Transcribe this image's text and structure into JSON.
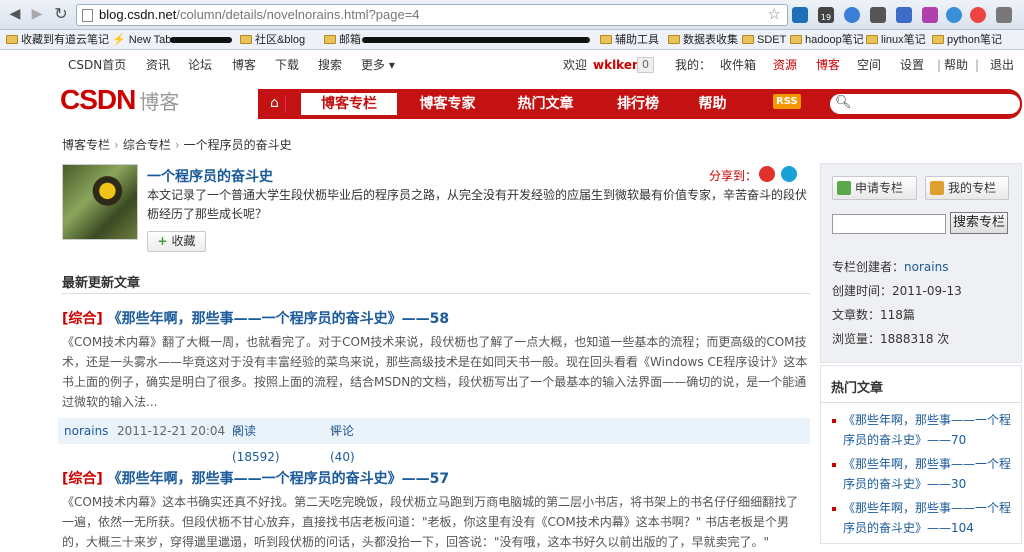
{
  "browser": {
    "url_host": "blog.csdn.net",
    "url_path": "/column/details/novelnorains.html?page=4",
    "bookmarks": [
      "收藏到有道云笔记",
      "New Tab",
      "社区&blog",
      "邮箱",
      "辅助工具",
      "数据表收集",
      "SDET",
      "hadoop笔记",
      "linux笔记",
      "python笔记"
    ],
    "ext_badge": "19"
  },
  "topnav": {
    "links": [
      "CSDN首页",
      "资讯",
      "论坛",
      "博客",
      "下载",
      "搜索",
      "更多 ▾"
    ],
    "welcome": "欢迎",
    "username": "wklken",
    "msg_count": "0",
    "my": "我的：",
    "right_links": [
      "收件箱",
      "资源",
      "博客",
      "空间",
      "设置",
      "帮助",
      "退出"
    ]
  },
  "header": {
    "logo": "CSDN",
    "logo_sub": "博客",
    "tabs": [
      "博客专栏",
      "博客专家",
      "热门文章",
      "排行榜",
      "帮助"
    ],
    "rss": "RSS"
  },
  "breadcrumb": [
    "博客专栏",
    "综合专栏",
    "一个程序员的奋斗史"
  ],
  "column": {
    "title": "一个程序员的奋斗史",
    "share_label": "分享到：",
    "description": "本文记录了一个普通大学生段伏枥毕业后的程序员之路，从完全没有开发经验的应届生到微软最有价值专家，辛苦奋斗的段伏枥经历了那些成长呢？",
    "fav_label": "收藏"
  },
  "section_title": "最新更新文章",
  "articles": [
    {
      "category": "[综合]",
      "title": "《那些年啊，那些事——一个程序员的奋斗史》——58",
      "body": "《COM技术内幕》翻了大概一周，也就看完了。对于COM技术来说，段伏枥也了解了一点大概，也知道一些基本的流程；而更高级的COM技术，还是一头雾水——毕竟这对于没有丰富经验的菜鸟来说，那些高级技术是在如同天书一般。现在回头看看《Windows CE程序设计》这本书上面的例子，确实是明白了很多。按照上面的流程，结合MSDN的文档，段伏枥写出了一个最基本的输入法界面——确切的说，是一个能通过微软的输入法...",
      "author": "norains",
      "date": "2011-12-21 20:04",
      "reads": "阅读(18592)",
      "comments": "评论(40)"
    },
    {
      "category": "[综合]",
      "title": "《那些年啊，那些事——一个程序员的奋斗史》——57",
      "body": "《COM技术内幕》这本书确实还真不好找。第二天吃完晚饭，段伏枥立马跑到万商电脑城的第二层小书店，将书架上的书名仔仔细细翻找了一遍，依然一无所获。但段伏枥不甘心放弃，直接找书店老板问道：\"老板，你这里有没有《COM技术内幕》这本书啊？\"        书店老板是个男的，大概三十来岁，穿得邋里邋遢，听到段伏枥的问话，头都没抬一下，回答说：\"没有哦，这本书好久以前出版的了，早就卖完了。\""
    }
  ],
  "sidebar": {
    "apply_btn": "申请专栏",
    "my_btn": "我的专栏",
    "search_btn": "搜索专栏",
    "creator_label": "专栏创建者：",
    "creator": "norains",
    "created_label": "创建时间：",
    "created": "2011-09-13",
    "count_label": "文章数：",
    "count": "118篇",
    "views_label": "浏览量：",
    "views": "1888318 次"
  },
  "hot": {
    "title": "热门文章",
    "items": [
      "《那些年啊，那些事——一个程序员的奋斗史》——70",
      "《那些年啊，那些事——一个程序员的奋斗史》——30",
      "《那些年啊，那些事——一个程序员的奋斗史》——104"
    ]
  }
}
